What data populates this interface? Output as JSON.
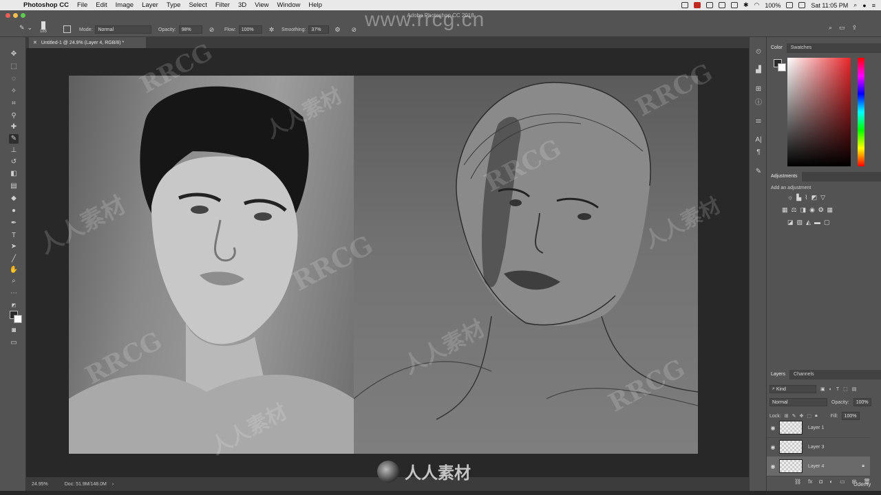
{
  "menubar": {
    "app_name": "Photoshop CC",
    "menus": [
      "File",
      "Edit",
      "Image",
      "Layer",
      "Type",
      "Select",
      "Filter",
      "3D",
      "View",
      "Window",
      "Help"
    ],
    "battery": "100%",
    "clock": "Sat 11:05 PM"
  },
  "window": {
    "title": "Adobe Photoshop CC 2018"
  },
  "options": {
    "brush_size": "185",
    "mode_label": "Mode:",
    "mode_value": "Normal",
    "opacity_label": "Opacity:",
    "opacity_value": "98%",
    "flow_label": "Flow:",
    "flow_value": "100%",
    "smoothing_label": "Smoothing:",
    "smoothing_value": "37%"
  },
  "document": {
    "tab_label": "Untitled-1 @ 24.9% (Layer 4, RGB/8) *",
    "zoom": "24.95%",
    "doc_info": "Doc: 51.9M/148.0M"
  },
  "color_panel": {
    "tabs": [
      "Color",
      "Swatches"
    ]
  },
  "adjustments_panel": {
    "title": "Adjustments",
    "hint": "Add an adjustment"
  },
  "layers_panel": {
    "tabs": [
      "Layers",
      "Channels"
    ],
    "filter_kind": "Kind",
    "blend_mode": "Normal",
    "opacity_label": "Opacity:",
    "opacity_value": "100%",
    "lock_label": "Lock:",
    "fill_label": "Fill:",
    "fill_value": "100%",
    "layers": [
      {
        "name": "Layer 1",
        "visible": true
      },
      {
        "name": "Layer 3",
        "visible": true
      },
      {
        "name": "Layer 4",
        "visible": true,
        "selected": true
      }
    ]
  },
  "watermark": {
    "url": "www.rrcg.cn",
    "text": "RRCG",
    "cn_text": "人人素材"
  },
  "branding": {
    "udemy": "Udemy"
  }
}
